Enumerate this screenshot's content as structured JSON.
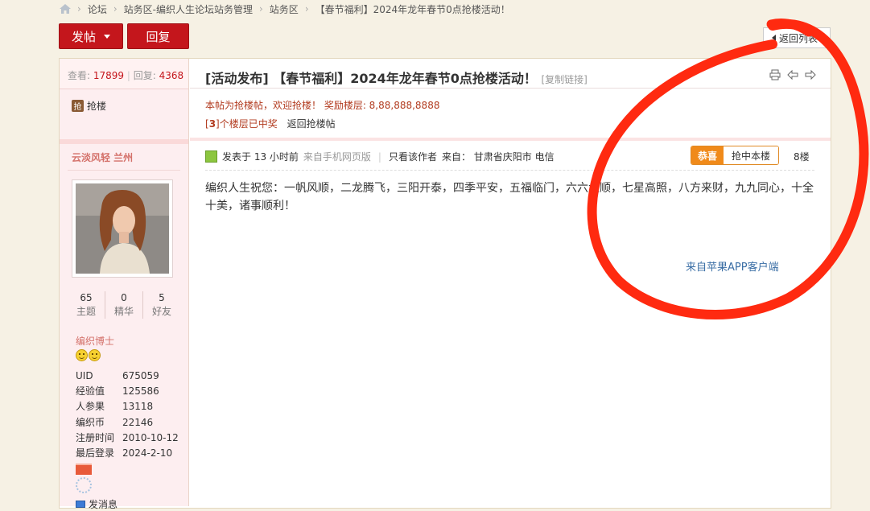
{
  "breadcrumb": {
    "items": [
      "论坛",
      "站务区-编织人生论坛站务管理",
      "站务区",
      "【春节福利】2024年龙年春节0点抢楼活动！"
    ]
  },
  "toolbar": {
    "post_label": "发帖",
    "reply_label": "回复",
    "back_label": "返回列表"
  },
  "thread": {
    "views_label": "查看:",
    "views": "17899",
    "replies_label": "回复:",
    "replies": "4368",
    "tag_icon": "抢",
    "tag_label": "抢楼",
    "title": "[活动发布] 【春节福利】2024年龙年春节0点抢楼活动！",
    "copy_link": "[复制链接]",
    "notice": "本帖为抢楼帖，欢迎抢楼！ 奖励楼层: 8,88,888,8888",
    "winners_prefix": "[",
    "winners_count": "3",
    "winners_suffix": "]个楼层已中奖",
    "back_to_thread": "返回抢楼帖"
  },
  "author": {
    "name": "云淡风轻 兰州",
    "stats": [
      {
        "value": "65",
        "label": "主题"
      },
      {
        "value": "0",
        "label": "精华"
      },
      {
        "value": "5",
        "label": "好友"
      }
    ],
    "rank": "编织博士",
    "info": [
      {
        "k": "UID",
        "v": "675059"
      },
      {
        "k": "经验值",
        "v": "125586"
      },
      {
        "k": "人参果",
        "v": "13118"
      },
      {
        "k": "编织币",
        "v": "22146"
      },
      {
        "k": "注册时间",
        "v": "2010-10-12"
      },
      {
        "k": "最后登录",
        "v": "2024-2-10"
      }
    ],
    "message": "发消息"
  },
  "post": {
    "posted": "发表于 13 小时前",
    "source": "来自手机网页版",
    "only_author": "只看该作者",
    "from": "来自：  甘肃省庆阳市 电信",
    "congrats": "恭喜",
    "won": "抢中本楼",
    "floor": "8楼",
    "body": "编织人生祝您：一帆风顺，二龙腾飞，三阳开泰，四季平安，五福临门，六六大顺，七星高照，八方来财，九九同心，十全十美，诸事顺利！",
    "client": "来自苹果APP客户端"
  },
  "colors": {
    "accent": "#c4161c",
    "marker": "#ff2a10",
    "badge": "#f08a1a"
  }
}
